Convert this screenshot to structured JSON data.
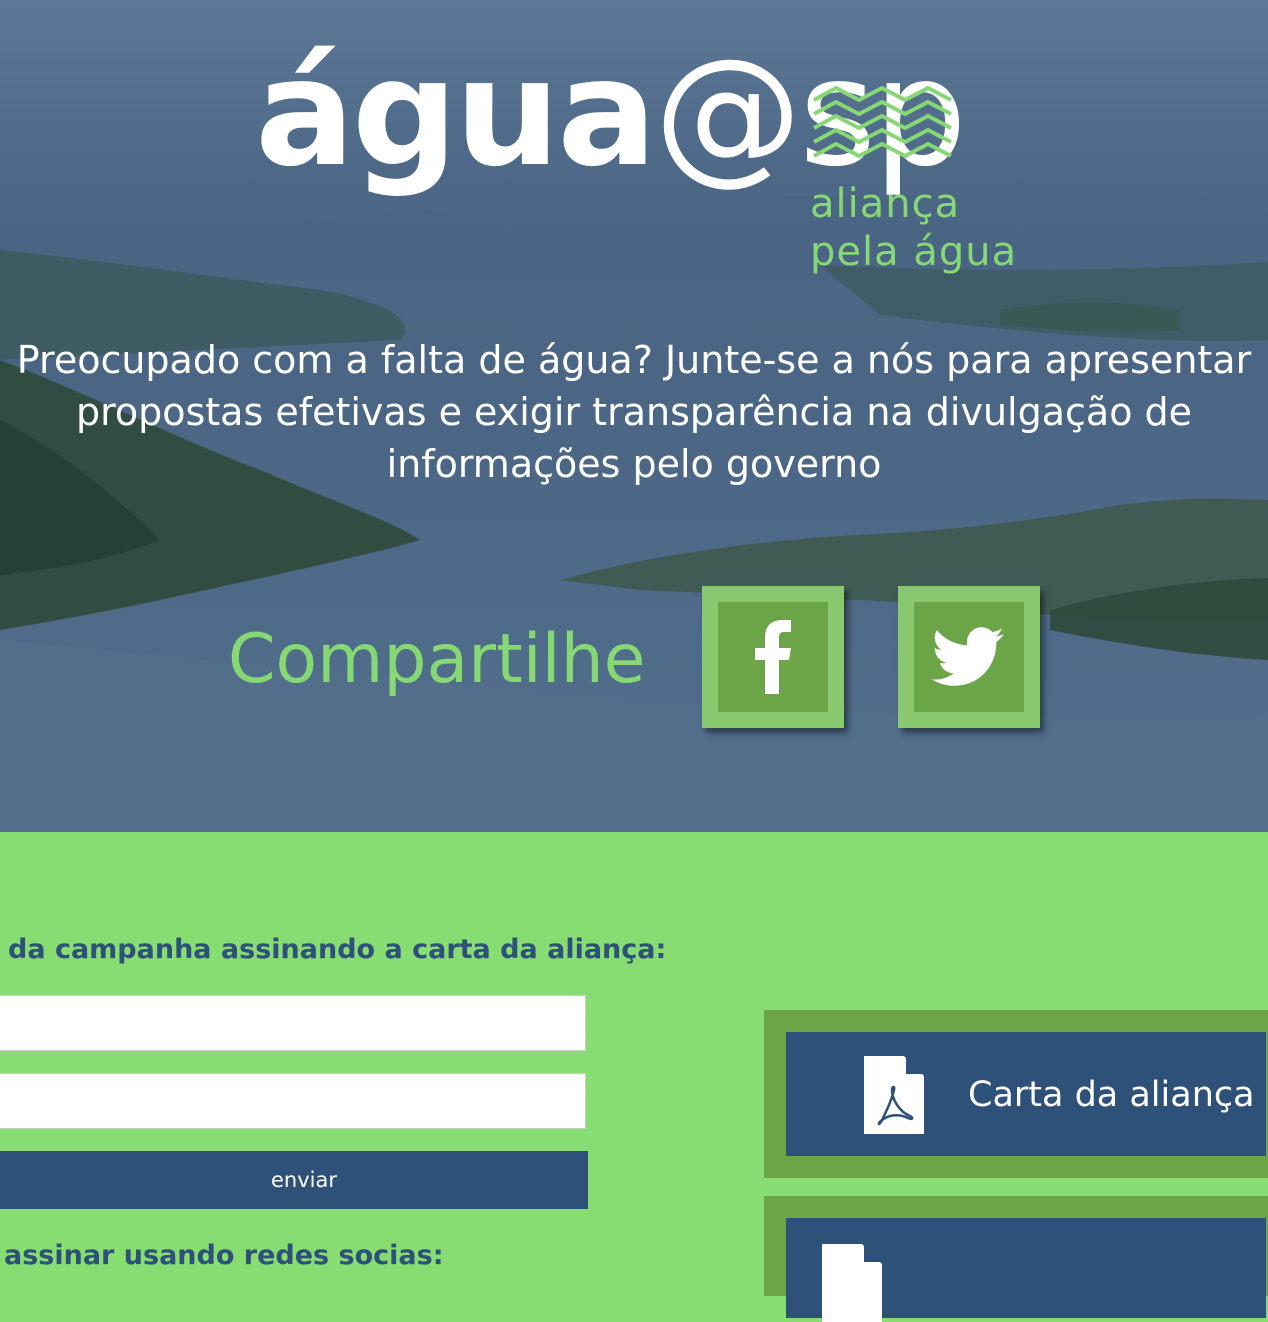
{
  "logo": {
    "word_bold": "água",
    "word_light": "@sp",
    "sub_line1": "aliança",
    "sub_line2": "pela água"
  },
  "hero": {
    "tagline_line1": "Preocupado com a falta de água? Junte-se a nós para apresentar",
    "tagline_line2": "propostas efetivas e exigir transparência na divulgação de",
    "tagline_line3": "informações pelo governo",
    "share_label": "Compartilhe",
    "share_buttons": [
      {
        "name": "facebook",
        "icon": "facebook-icon"
      },
      {
        "name": "twitter",
        "icon": "twitter-icon"
      }
    ]
  },
  "form": {
    "intro": "da campanha assinando a carta da aliança:",
    "name_value": "",
    "email_value": "",
    "submit_label": "enviar",
    "social_intro": "assinar usando redes socias:"
  },
  "documents": [
    {
      "label": "Carta da aliança",
      "icon": "pdf-file-icon"
    },
    {
      "label": "",
      "icon": "pdf-file-icon"
    }
  ],
  "colors": {
    "brand_green": "#86d874",
    "dark_green": "#6ca548",
    "navy": "#2d5179",
    "page_green": "#87dc72"
  }
}
